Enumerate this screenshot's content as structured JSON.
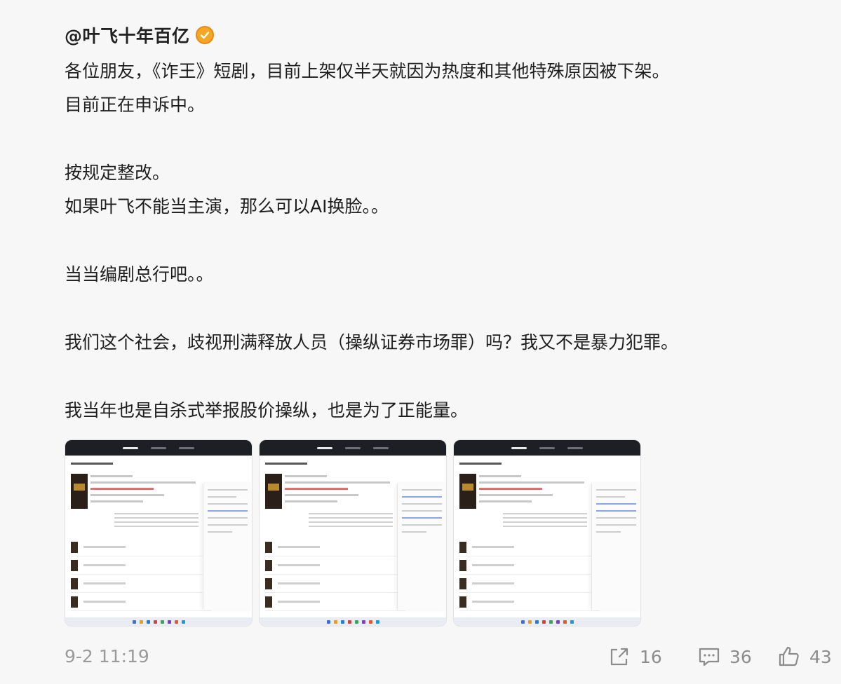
{
  "post": {
    "author": "@叶飞十年百亿",
    "lines": [
      "各位朋友，《诈王》短剧，目前上架仅半天就因为热度和其他特殊原因被下架。",
      "目前正在申诉中。",
      "",
      "按规定整改。",
      "如果叶飞不能当主演，那么可以AI换脸。。",
      "",
      "当当编剧总行吧。。",
      "",
      "我们这个社会，歧视刑满释放人员（操纵证券市场罪）吗？我又不是暴力犯罪。",
      "",
      "我当年也是自杀式举报股价操纵，也是为了正能量。"
    ],
    "images": [
      {
        "icon": "screenshot-thumbnail"
      },
      {
        "icon": "screenshot-thumbnail"
      },
      {
        "icon": "screenshot-thumbnail"
      }
    ],
    "timestamp": "9-2 11:19"
  },
  "actions": {
    "share_count": "16",
    "comment_count": "36",
    "like_count": "43",
    "icons": [
      "share-icon",
      "comment-icon",
      "like-icon"
    ]
  },
  "colors": {
    "verified_badge": "#f5a623",
    "meta_text": "#9a9a9a",
    "background": "#f7f7f7"
  }
}
